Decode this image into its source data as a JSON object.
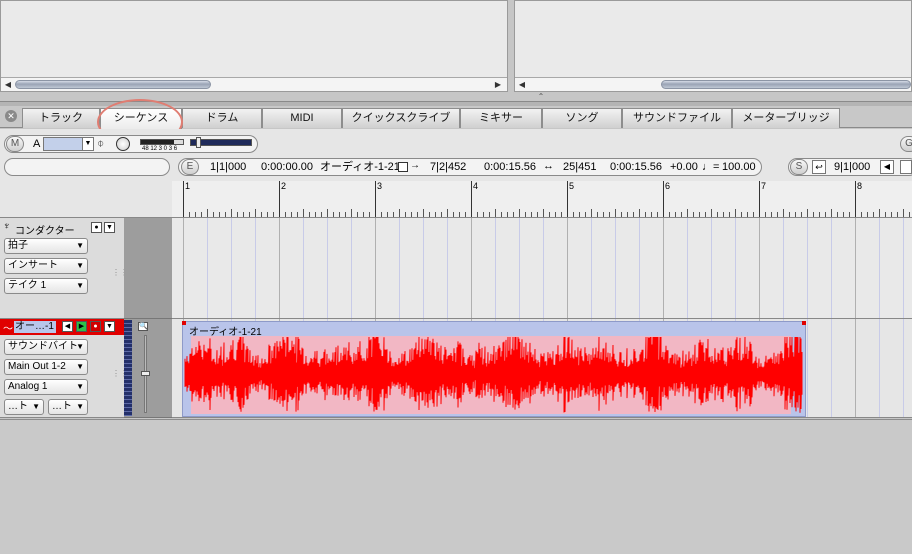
{
  "tabs": [
    {
      "label": "トラック",
      "active": false
    },
    {
      "label": "シーケンス",
      "active": true
    },
    {
      "label": "ドラム",
      "active": false
    },
    {
      "label": "MIDI",
      "active": false
    },
    {
      "label": "クイックスクライブ",
      "active": false
    },
    {
      "label": "ミキサー",
      "active": false
    },
    {
      "label": "ソング",
      "active": false
    },
    {
      "label": "サウンドファイル",
      "active": false
    },
    {
      "label": "メーターブリッジ",
      "active": false
    }
  ],
  "toolbar": {
    "m_button": "M",
    "c_button": "C",
    "e_button": "E",
    "s_button": "S",
    "g_button": "G",
    "track_a_label": "A",
    "level_scale": "48 12 3 0 3 6"
  },
  "counters": {
    "start_position": "1|1|000",
    "start_time": "0:00:00.00",
    "sequence_name": "オーディオ-1-21",
    "end_position": "7|2|452",
    "end_time": "0:00:15.56",
    "length_position": "25|451",
    "length_time": "0:00:15.56",
    "offset": "+0.00",
    "tempo_prefix": "♩=",
    "tempo": "100.00",
    "right_position": "9|1|000"
  },
  "ruler": {
    "bars": [
      "1",
      "2",
      "3",
      "4",
      "5",
      "6",
      "7",
      "8"
    ]
  },
  "conductor": {
    "title": "コンダクター",
    "rows": [
      "拍子",
      "インサート",
      "テイク 1"
    ]
  },
  "audio_track": {
    "name": "オー…-1",
    "rows": [
      "サウンドバイト",
      "Main Out 1-2",
      "Analog 1"
    ],
    "small_left": "…ト",
    "small_right": "…ト",
    "region_name": "オーディオ-1-21"
  },
  "colors": {
    "waveform": "#ff0000",
    "region_fill": "#b9c4ea",
    "track_header_red": "#e00000",
    "annotation": "#e07d72"
  }
}
